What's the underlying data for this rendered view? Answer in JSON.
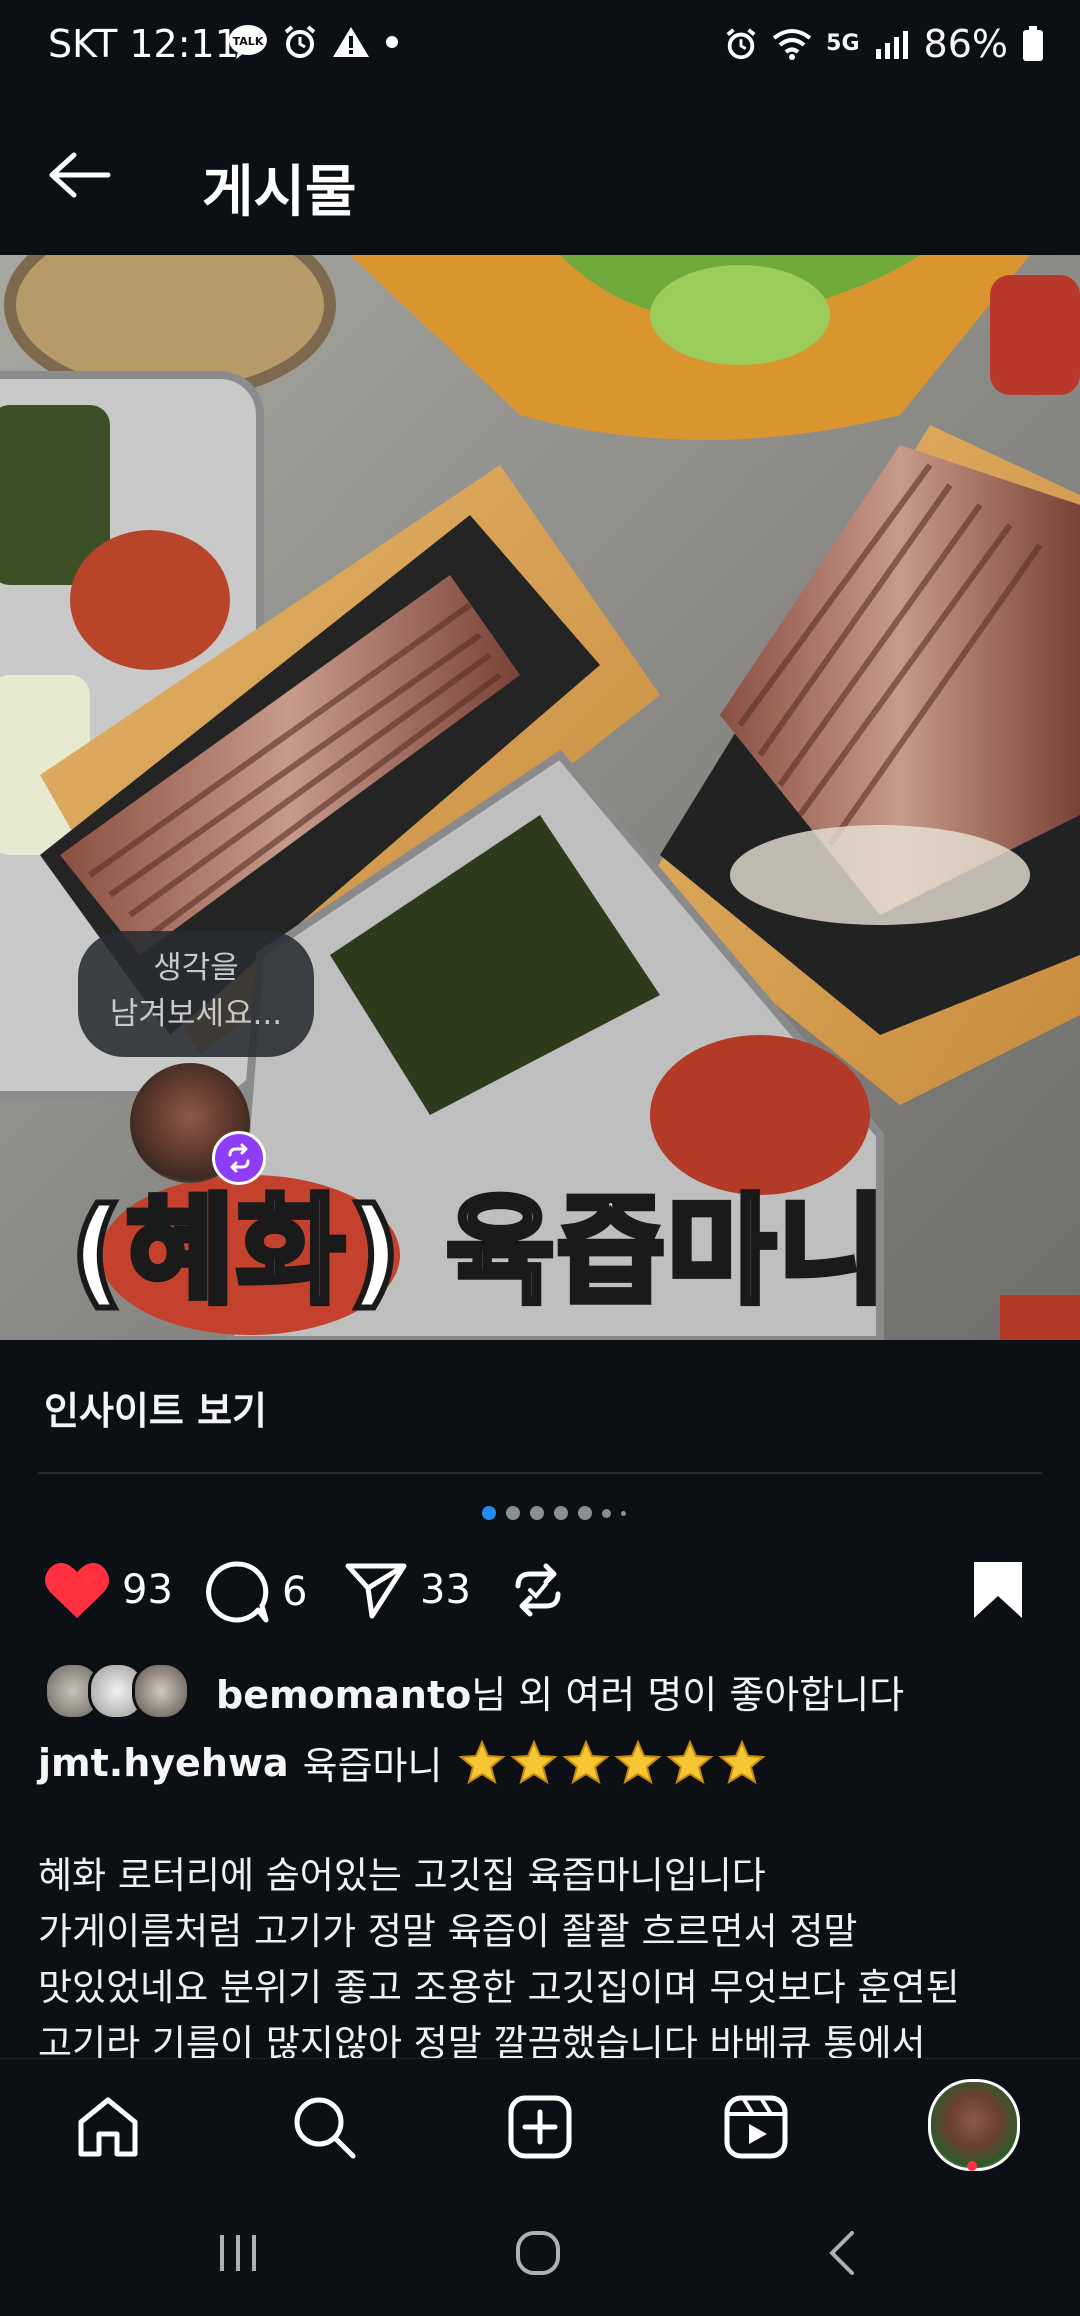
{
  "status_bar": {
    "carrier_time": "SKT 12:11",
    "battery": "86%",
    "network": "5G"
  },
  "header": {
    "title": "게시물"
  },
  "post_image": {
    "bubble_line1": "생각을",
    "bubble_line2": "남겨보세요...",
    "overlay_text": "(혜화) 육즙마니"
  },
  "insights": {
    "label": "인사이트 보기"
  },
  "carousel": {
    "total": 7,
    "active_index": 0
  },
  "actions": {
    "likes": "93",
    "comments": "6",
    "shares": "33"
  },
  "likes_line": {
    "user": "bemomanto",
    "suffix": "님 외 여러 명이 좋아합니다"
  },
  "caption": {
    "user": "jmt.hyehwa",
    "title": "육즙마니",
    "rating": 6,
    "lines": [
      "혜화 로터리에 숨어있는 고깃집 육즙마니입니다",
      "가게이름처럼 고기가 정말 육즙이 좔좔 흐르면서 정말",
      "맛있었네요 분위기 좋고 조용한 고깃집이며 무엇보다 훈연된",
      "고기라 기름이 많지않아 정말 깔끔했습니다 바베큐 통에서"
    ]
  },
  "colors": {
    "background": "#0c1014",
    "like_red": "#ff3040",
    "active_dot": "#1f8cf3",
    "repost_purple": "#8e3ef7"
  }
}
